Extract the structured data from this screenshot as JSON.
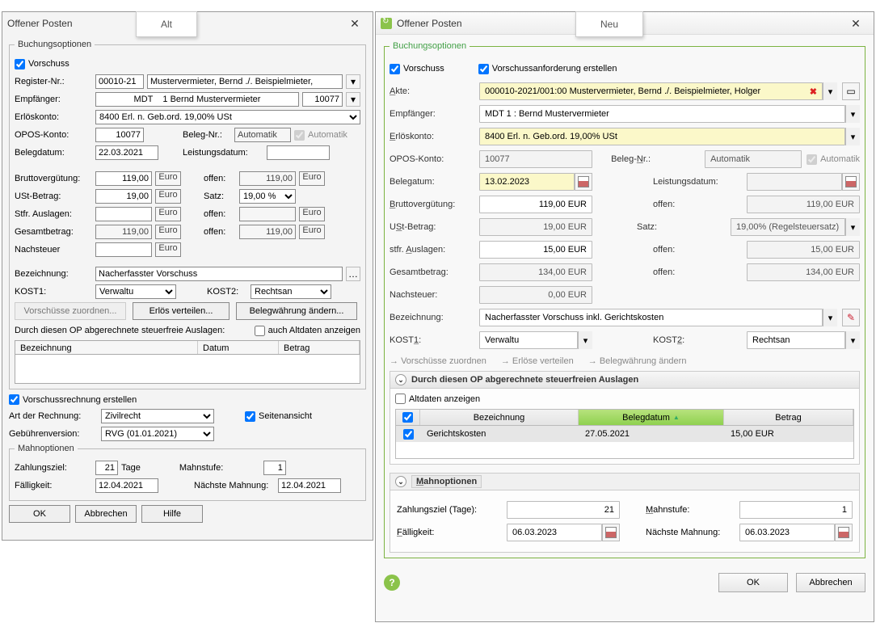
{
  "labels": {
    "alt": "Alt",
    "neu": "Neu"
  },
  "old": {
    "title": "Offener Posten",
    "buchungsoptionen_legend": "Buchungsoptionen",
    "vorschuss_label": "Vorschuss",
    "register_nr_label": "Register-Nr.:",
    "register_nr_value": "00010-21",
    "register_akte_value": "Mustervermieter, Bernd ./. Beispielmieter,",
    "empfaenger_label": "Empfänger:",
    "empfaenger_value": "MDT    1 Bernd Mustervermieter",
    "empfaenger_id": "10077",
    "erloeskonto_label": "Erlöskonto:",
    "erloeskonto_value": "8400  Erl. n. Geb.ord. 19,00% USt",
    "opos_konto_label": "OPOS-Konto:",
    "opos_konto_value": "10077",
    "beleg_nr_label": "Beleg-Nr.:",
    "beleg_nr_value": "Automatik",
    "automatik_label": "Automatik",
    "belegdatum_label": "Belegdatum:",
    "belegdatum_value": "22.03.2021",
    "leistungsdatum_label": "Leistungsdatum:",
    "brutto_label": "Bruttovergütung:",
    "brutto_value": "119,00",
    "euro": "Euro",
    "offen_label": "offen:",
    "brutto_offen": "119,00",
    "ust_label": "USt-Betrag:",
    "ust_value": "19,00",
    "satz_label": "Satz:",
    "satz_value": "19,00 %",
    "stfr_label": "Stfr. Auslagen:",
    "gesamt_label": "Gesamtbetrag:",
    "gesamt_value": "119,00",
    "gesamt_offen": "119,00",
    "nachsteuer_label": "Nachsteuer",
    "bezeichnung_label": "Bezeichnung:",
    "bezeichnung_value": "Nacherfasster Vorschuss",
    "kost1_label": "KOST1:",
    "kost1_value": "Verwaltu",
    "kost2_label": "KOST2:",
    "kost2_value": "Rechtsan",
    "btn_vorschuesse": "Vorschüsse zuordnen...",
    "btn_erloes": "Erlös verteilen...",
    "btn_waehrung": "Belegwährung ändern...",
    "abger_auslagen_label": "Durch diesen OP abgerechnete steuerfreie Auslagen:",
    "altdaten_label": "auch Altdaten anzeigen",
    "grid": {
      "c1": "Bezeichnung",
      "c2": "Datum",
      "c3": "Betrag"
    },
    "vorschussrechnung_label": "Vorschussrechnung erstellen",
    "art_label": "Art der Rechnung:",
    "art_value": "Zivilrecht",
    "seitenansicht_label": "Seitenansicht",
    "gebuehr_label": "Gebührenversion:",
    "gebuehr_value": "RVG (01.01.2021)",
    "mahnoptionen_legend": "Mahnoptionen",
    "zahlungszeil_label": "Zahlungsziel:",
    "zahlungszeil_value": "21",
    "tage": "Tage",
    "mahnstufe_label": "Mahnstufe:",
    "mahnstufe_value": "1",
    "faelligkeit_label": "Fälligkeit:",
    "faelligkeit_value": "12.04.2021",
    "naechste_mahnung_label": "Nächste Mahnung:",
    "naechste_mahnung_value": "12.04.2021",
    "btn_ok": "OK",
    "btn_abbrechen": "Abbrechen",
    "btn_hilfe": "Hilfe"
  },
  "neu": {
    "title": "Offener Posten",
    "buchungsoptionen_legend": "Buchungsoptionen",
    "vorschuss_label": "Vorschuss",
    "vr_anforderung_label": "Vorschussanforderung erstellen",
    "akte_label": "Akte:",
    "akte_value": "000010-2021/001:00  Mustervermieter, Bernd ./. Beispielmieter, Holger",
    "empfaenger_label": "Empfänger:",
    "empfaenger_value": "MDT 1 : Bernd Mustervermieter",
    "erloeskonto_label": "Erlöskonto:",
    "erloeskonto_value": "8400  Erl. n. Geb.ord. 19,00% USt",
    "opos_konto_label": "OPOS-Konto:",
    "opos_konto_value": "10077",
    "beleg_nr_label": "Beleg-Nr.:",
    "beleg_nr_value": "Automatik",
    "automatik_label": "Automatik",
    "belegatum_label": "Belegatum:",
    "belegatum_value": "13.02.2023",
    "leistungsdatum_label": "Leistungsdatum:",
    "brutto_label": "Bruttovergütung:",
    "brutto_value": "119,00 EUR",
    "brutto_offen": "119,00 EUR",
    "offen_label": "offen:",
    "ust_label": "USt-Betrag:",
    "ust_value": "19,00 EUR",
    "satz_label": "Satz:",
    "satz_value": "19,00% (Regelsteuersatz)",
    "stfr_label": "stfr. Auslagen:",
    "stfr_value": "15,00 EUR",
    "stfr_offen": "15,00 EUR",
    "gesamt_label": "Gesamtbetrag:",
    "gesamt_value": "134,00 EUR",
    "gesamt_offen": "134,00 EUR",
    "nachsteuer_label": "Nachsteuer:",
    "nachsteuer_value": "0,00 EUR",
    "bezeichnung_label": "Bezeichnung:",
    "bezeichnung_value": "Nacherfasster Vorschuss inkl. Gerichtskosten",
    "kost1_label": "KOST1:",
    "kost1_value": "Verwaltu",
    "kost2_label": "KOST2:",
    "kost2_value": "Rechtsan",
    "link_vorschuesse": "Vorschüsse zuordnen",
    "link_erloese": "Erlöse verteilen",
    "link_waehrung": "Belegwährung ändern",
    "sec_auslagen": "Durch diesen OP abgerechnete steuerfreien Auslagen",
    "altdaten_label": "Altdaten anzeigen",
    "thead": {
      "c1": "Bezeichnung",
      "c2": "Belegdatum",
      "c3": "Betrag"
    },
    "row1": {
      "bez": "Gerichtskosten",
      "datum": "27.05.2021",
      "betrag": "15,00 EUR"
    },
    "sec_mahn": "Mahnoptionen",
    "zahlungsziel_label": "Zahlungsziel (Tage):",
    "zahlungsziel_value": "21",
    "mahnstufe_label": "Mahnstufe:",
    "mahnstufe_value": "1",
    "faelligkeit_label": "Fälligkeit:",
    "faelligkeit_value": "06.03.2023",
    "naechste_mahnung_label": "Nächste Mahnung:",
    "naechste_mahnung_value": "06.03.2023",
    "btn_ok": "OK",
    "btn_abbrechen": "Abbrechen"
  }
}
